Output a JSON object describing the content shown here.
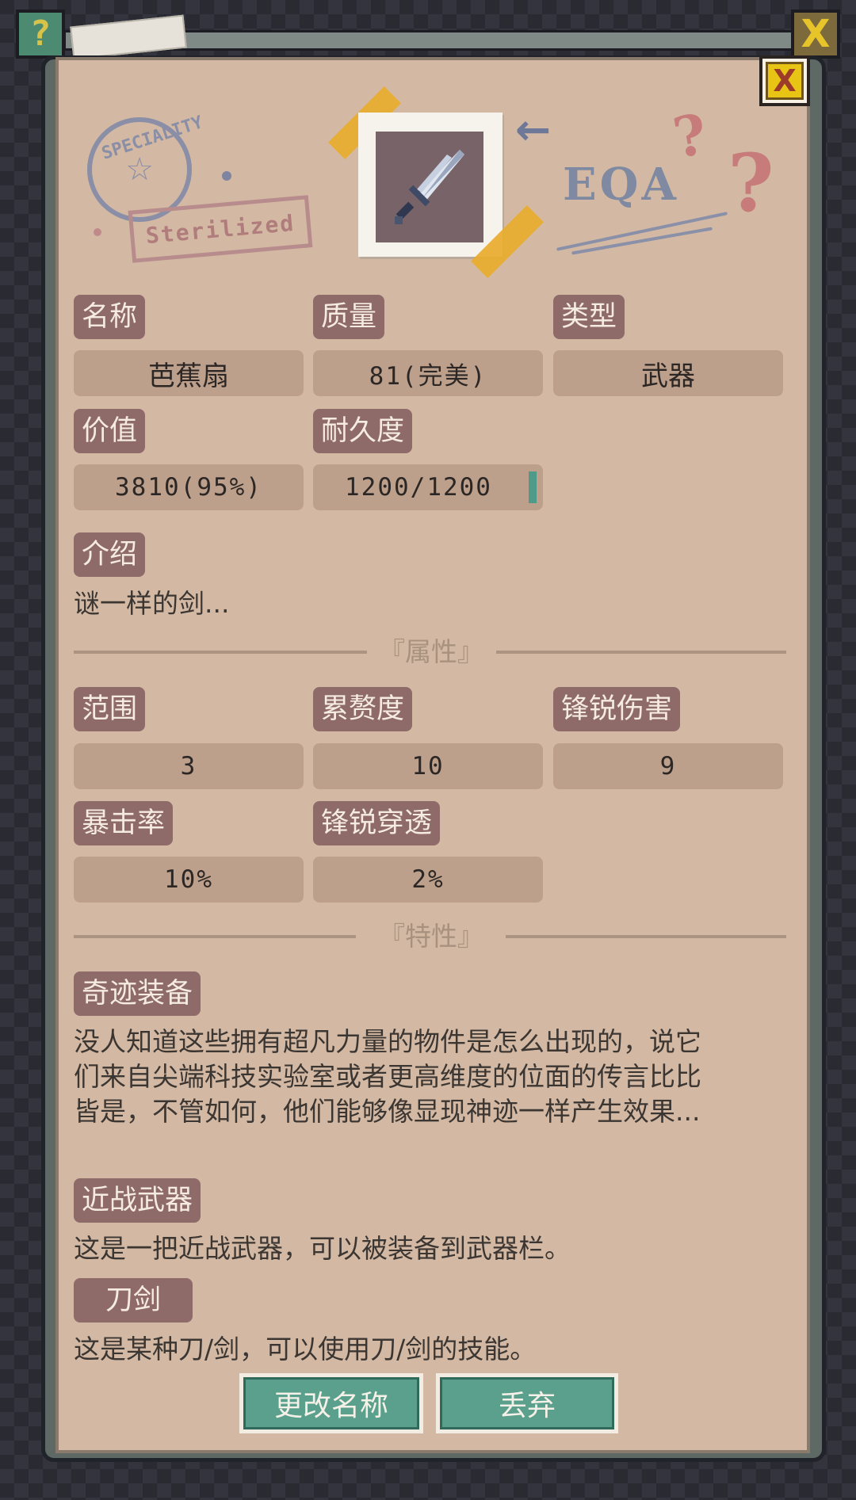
{
  "header": {
    "help_glyph": "?",
    "close_glyph": "X"
  },
  "decor": {
    "stamp_ring_text": "SPECIALITY",
    "stamp_star": "☆",
    "stamp_label": "Sterilized",
    "arrow": "←",
    "eqa": "EQA",
    "question": "?",
    "tape_color": "#e8ac2e"
  },
  "item": {
    "icon": "sword-icon",
    "name_label": "名称",
    "name_value": "芭蕉扇",
    "quality_label": "质量",
    "quality_value": "81(完美)",
    "type_label": "类型",
    "type_value": "武器",
    "value_label": "价值",
    "value_value": "3810(95%)",
    "durability_label": "耐久度",
    "durability_value": "1200/1200",
    "durability_fraction": 1.0,
    "intro_label": "介绍",
    "intro_text": "谜一样的剑..."
  },
  "attributes": {
    "title": "『属性』",
    "range_label": "范围",
    "range_value": "3",
    "fatigue_label": "累赘度",
    "fatigue_value": "10",
    "sharp_damage_label": "锋锐伤害",
    "sharp_damage_value": "9",
    "crit_label": "暴击率",
    "crit_value": "10%",
    "pierce_label": "锋锐穿透",
    "pierce_value": "2%"
  },
  "traits": {
    "title": "『特性』",
    "miracle_label": "奇迹装备",
    "miracle_lines": [
      "没人知道这些拥有超凡力量的物件是怎么出现的，说它",
      "们来自尖端科技实验室或者更高维度的位面的传言比比",
      "皆是，不管如何，他们能够像显现神迹一样产生效果..."
    ],
    "melee_label": "近战武器",
    "melee_text": "这是一把近战武器，可以被装备到武器栏。",
    "blade_label": "刀剑",
    "blade_text": "这是某种刀/剑，可以使用刀/剑的技能。"
  },
  "actions": {
    "rename": "更改名称",
    "discard": "丢弃"
  },
  "colors": {
    "panel": "#d3b9a3",
    "label_bg": "#8e6b68",
    "value_bg": "#bca08b",
    "button_green": "#5aa08c",
    "close_yellow": "#e8c414"
  }
}
